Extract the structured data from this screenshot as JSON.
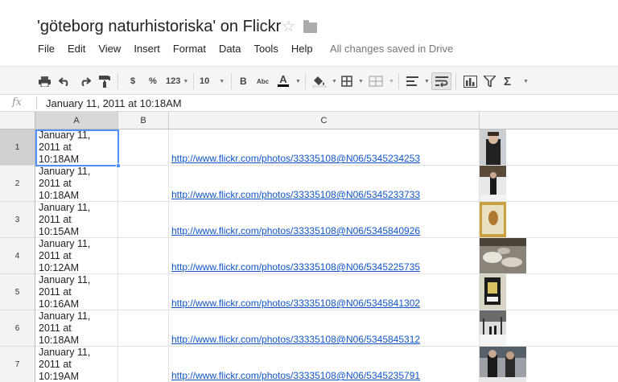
{
  "document": {
    "title": "'göteborg naturhistoriska' on Flickr",
    "save_status": "All changes saved in Drive"
  },
  "menu": [
    "File",
    "Edit",
    "View",
    "Insert",
    "Format",
    "Data",
    "Tools",
    "Help"
  ],
  "toolbar": {
    "currency_label": "$",
    "percent_label": "%",
    "number_format_label": "123",
    "font_size": "10",
    "bold_label": "B",
    "strike_label": "Abc",
    "text_color_label": "A"
  },
  "formula_bar": {
    "fx_label": "fx",
    "value": "January 11, 2011 at 10:18AM"
  },
  "columns": [
    "A",
    "B",
    "C"
  ],
  "rows": [
    {
      "num": "1",
      "a_lines": [
        "January 11,",
        "2011 at",
        "10:18AM"
      ],
      "link": "http://www.flickr.com/photos/33335108@N06/5345234253",
      "thumb": "person-portrait"
    },
    {
      "num": "2",
      "a_lines": [
        "January 11,",
        "2011 at",
        "10:18AM"
      ],
      "link": "http://www.flickr.com/photos/33335108@N06/5345233733",
      "thumb": "person-snow"
    },
    {
      "num": "3",
      "a_lines": [
        "January 11,",
        "2011 at",
        "10:15AM"
      ],
      "link": "http://www.flickr.com/photos/33335108@N06/5345840926",
      "thumb": "specimen"
    },
    {
      "num": "4",
      "a_lines": [
        "January 11,",
        "2011 at",
        "10:12AM"
      ],
      "link": "http://www.flickr.com/photos/33335108@N06/5345225735",
      "thumb": "snowy-ground"
    },
    {
      "num": "5",
      "a_lines": [
        "January 11,",
        "2011 at",
        "10:16AM"
      ],
      "link": "http://www.flickr.com/photos/33335108@N06/5345841302",
      "thumb": "framed-specimen"
    },
    {
      "num": "6",
      "a_lines": [
        "January 11,",
        "2011 at",
        "10:18AM"
      ],
      "link": "http://www.flickr.com/photos/33335108@N06/5345845312",
      "thumb": "snow-path"
    },
    {
      "num": "7",
      "a_lines": [
        "January 11,",
        "2011 at",
        "10:19AM"
      ],
      "link": "http://www.flickr.com/photos/33335108@N06/5345235791",
      "thumb": "people-snow"
    }
  ],
  "colors": {
    "accent": "#4d90fe",
    "link": "#1155cc"
  }
}
